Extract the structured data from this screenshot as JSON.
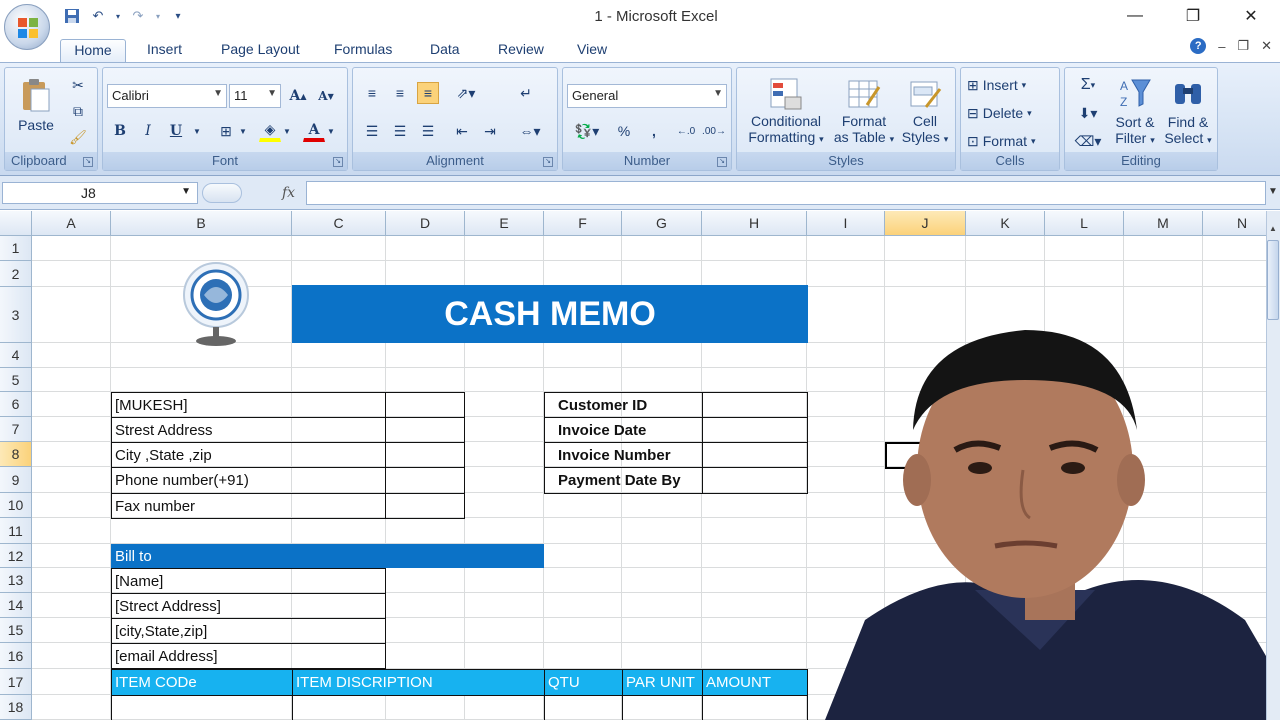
{
  "window": {
    "title": "1 - Microsoft Excel"
  },
  "tabs": [
    "Home",
    "Insert",
    "Page Layout",
    "Formulas",
    "Data",
    "Review",
    "View"
  ],
  "active_tab": "Home",
  "ribbon": {
    "clipboard": {
      "label": "Clipboard",
      "paste": "Paste"
    },
    "font": {
      "label": "Font",
      "family": "Calibri",
      "size": "11",
      "bold": "B",
      "italic": "I",
      "underline": "U",
      "grow": "A",
      "shrink": "A",
      "color": "A"
    },
    "alignment": {
      "label": "Alignment"
    },
    "number": {
      "label": "Number",
      "format": "General",
      "percent": "%",
      "comma": ","
    },
    "styles": {
      "label": "Styles",
      "conditional": [
        "Conditional",
        "Formatting"
      ],
      "format_table": [
        "Format",
        "as Table"
      ],
      "cell_styles": [
        "Cell",
        "Styles"
      ]
    },
    "cells": {
      "label": "Cells",
      "insert": "Insert",
      "delete": "Delete",
      "format": "Format"
    },
    "editing": {
      "label": "Editing",
      "sum": "Σ",
      "sort": [
        "Sort &",
        "Filter"
      ],
      "find": [
        "Find &",
        "Select"
      ]
    }
  },
  "formula_bar": {
    "name_box": "J8",
    "fx": "fx",
    "formula": ""
  },
  "columns": [
    "A",
    "B",
    "C",
    "D",
    "E",
    "F",
    "G",
    "H",
    "I",
    "J",
    "K",
    "L",
    "M",
    "N"
  ],
  "selected_column": "J",
  "rows": [
    "1",
    "2",
    "3",
    "4",
    "5",
    "6",
    "7",
    "8",
    "9",
    "10",
    "11",
    "12",
    "13",
    "14",
    "15",
    "16",
    "17",
    "18"
  ],
  "selected_row": "8",
  "sheet": {
    "banner": "CASH MEMO",
    "company": [
      "[MUKESH]",
      "Strest  Address",
      "City ,State ,zip",
      "Phone number(+91)",
      "Fax number"
    ],
    "customer_labels": [
      "Customer ID",
      "Invoice Date",
      "Invoice Number",
      "Payment Date By"
    ],
    "bill_to": "Bill to",
    "bill_lines": [
      "[Name]",
      "[Strect Address]",
      "[city,State,zip]",
      "[email Address]"
    ],
    "item_headers": [
      "ITEM CODe",
      "ITEM DISCRIPTION",
      "QTU",
      "PAR UNIT",
      "AMOUNT"
    ]
  },
  "colors": {
    "banner": "#0b72c7",
    "bill_to": "#0b72c7",
    "item_header": "#17b2f0",
    "ribbon": "#d3e1f3"
  }
}
